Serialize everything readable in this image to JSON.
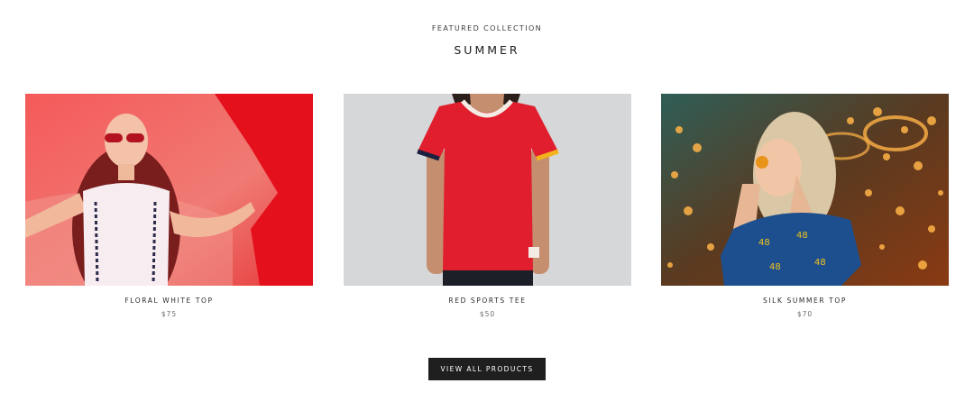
{
  "collection": {
    "eyebrow": "FEATURED COLLECTION",
    "title": "SUMMER"
  },
  "products": [
    {
      "name": "FLORAL WHITE TOP",
      "price": "$75",
      "image": "photo-woman-red-sunglasses-white-top"
    },
    {
      "name": "RED SPORTS TEE",
      "price": "$50",
      "image": "photo-red-tee-on-model"
    },
    {
      "name": "SILK SUMMER TOP",
      "price": "$70",
      "image": "photo-woman-carnival-lights"
    }
  ],
  "cta": {
    "label": "VIEW ALL PRODUCTS"
  },
  "colors": {
    "button_bg": "#1f1f1f",
    "text": "#1c1c1c",
    "price": "#6b6b6b"
  }
}
